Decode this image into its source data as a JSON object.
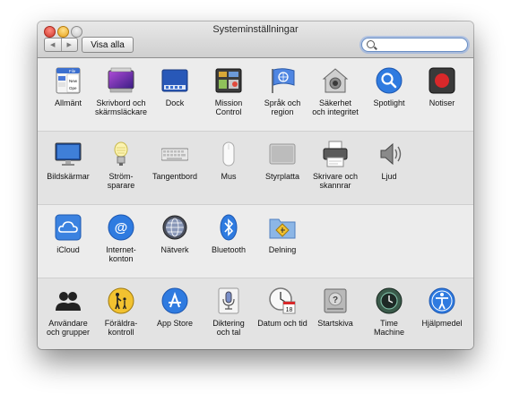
{
  "window": {
    "title": "Systeminställningar",
    "show_all_label": "Visa alla",
    "back_glyph": "◀",
    "forward_glyph": "▶",
    "search": {
      "value": "",
      "placeholder": ""
    }
  },
  "sections": [
    {
      "items": [
        {
          "id": "general",
          "label": "Allmänt",
          "icon": "general-icon",
          "icon_text": [
            "File",
            "New",
            "Ope"
          ]
        },
        {
          "id": "desktop",
          "label": "Skrivbord och\nskärmsläckare",
          "icon": "desktop-screensaver-icon"
        },
        {
          "id": "dock",
          "label": "Dock",
          "icon": "dock-icon"
        },
        {
          "id": "mission",
          "label": "Mission\nControl",
          "icon": "mission-control-icon"
        },
        {
          "id": "language",
          "label": "Språk och\nregion",
          "icon": "language-region-icon"
        },
        {
          "id": "security",
          "label": "Säkerhet\noch integritet",
          "icon": "security-privacy-icon"
        },
        {
          "id": "spotlight",
          "label": "Spotlight",
          "icon": "spotlight-icon"
        },
        {
          "id": "notifications",
          "label": "Notiser",
          "icon": "notifications-icon"
        }
      ]
    },
    {
      "items": [
        {
          "id": "displays",
          "label": "Bildskärmar",
          "icon": "displays-icon"
        },
        {
          "id": "energy",
          "label": "Ström-\nsparare",
          "icon": "energy-saver-icon"
        },
        {
          "id": "keyboard",
          "label": "Tangentbord",
          "icon": "keyboard-icon"
        },
        {
          "id": "mouse",
          "label": "Mus",
          "icon": "mouse-icon"
        },
        {
          "id": "trackpad",
          "label": "Styrplatta",
          "icon": "trackpad-icon"
        },
        {
          "id": "printers",
          "label": "Skrivare och\nskannrar",
          "icon": "printers-scanners-icon"
        },
        {
          "id": "sound",
          "label": "Ljud",
          "icon": "sound-icon"
        }
      ]
    },
    {
      "items": [
        {
          "id": "icloud",
          "label": "iCloud",
          "icon": "icloud-icon"
        },
        {
          "id": "internet",
          "label": "Internet-\nkonton",
          "icon": "internet-accounts-icon"
        },
        {
          "id": "network",
          "label": "Nätverk",
          "icon": "network-icon"
        },
        {
          "id": "bluetooth",
          "label": "Bluetooth",
          "icon": "bluetooth-icon"
        },
        {
          "id": "sharing",
          "label": "Delning",
          "icon": "sharing-icon"
        }
      ]
    },
    {
      "items": [
        {
          "id": "users",
          "label": "Användare\noch grupper",
          "icon": "users-groups-icon"
        },
        {
          "id": "parental",
          "label": "Föräldra-\nkontroll",
          "icon": "parental-controls-icon"
        },
        {
          "id": "appstore",
          "label": "App Store",
          "icon": "app-store-icon"
        },
        {
          "id": "dictation",
          "label": "Diktering\noch tal",
          "icon": "dictation-speech-icon"
        },
        {
          "id": "datetime",
          "label": "Datum och tid",
          "icon": "date-time-icon",
          "icon_text": [
            "18"
          ]
        },
        {
          "id": "startup",
          "label": "Startskiva",
          "icon": "startup-disk-icon",
          "icon_text": [
            "?"
          ]
        },
        {
          "id": "timemachine",
          "label": "Time\nMachine",
          "icon": "time-machine-icon"
        },
        {
          "id": "accessibility",
          "label": "Hjälpmedel",
          "icon": "accessibility-icon"
        }
      ]
    }
  ],
  "colors": {
    "accent_blue": "#2f7be0",
    "notification_red": "#d8282a"
  }
}
